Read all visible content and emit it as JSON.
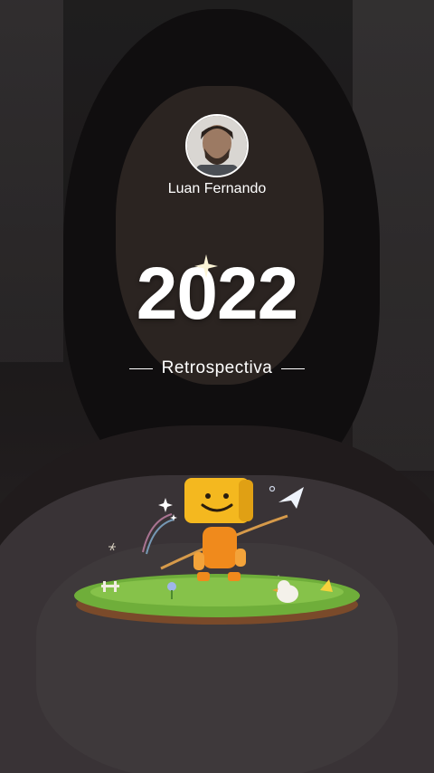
{
  "profile": {
    "name": "Luan Fernando"
  },
  "story": {
    "year": "2022",
    "subtitle": "Retrospectiva"
  },
  "icons": [
    "sparkle-icon",
    "paper-plane-icon",
    "smiley-box-mascot"
  ],
  "colors": {
    "text": "#ffffff",
    "grass": "#6fae3a",
    "mascot": "#f4b81f",
    "mascot_body": "#f08a1c"
  }
}
